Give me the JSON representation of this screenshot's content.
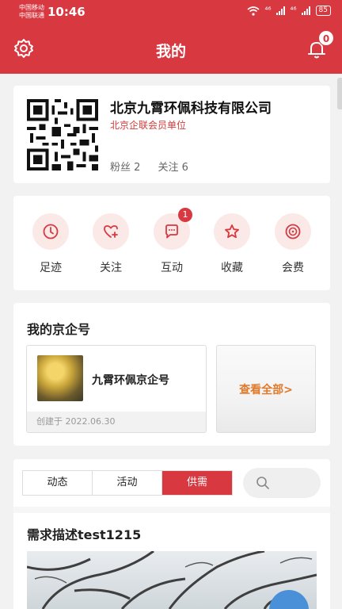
{
  "status": {
    "carrier_1": "中国移动",
    "carrier_2": "中国联通",
    "time": "10:46",
    "signal_1": "⁴⁶",
    "signal_2": "⁴⁶",
    "battery": "85"
  },
  "header": {
    "title": "我的",
    "notification_count": "0",
    "accent": "#d8383f"
  },
  "profile": {
    "company_name": "北京九霄环佩科技有限公司",
    "member_tag": "北京企联会员单位",
    "fans_label": "粉丝",
    "fans_count": "2",
    "follow_label": "关注",
    "follow_count": "6"
  },
  "actions": [
    {
      "label": "足迹",
      "icon": "clock-icon"
    },
    {
      "label": "关注",
      "icon": "heart-plus-icon"
    },
    {
      "label": "互动",
      "icon": "chat-bubble-icon",
      "badge": "1"
    },
    {
      "label": "收藏",
      "icon": "star-icon"
    },
    {
      "label": "会费",
      "icon": "coin-icon"
    }
  ],
  "jingqi": {
    "title": "我的京企号",
    "item_name": "九霄环佩京企号",
    "item_date": "创建于 2022.06.30",
    "view_all": "查看全部>",
    "view_all_color": "#e07a2a"
  },
  "feed": {
    "tabs": [
      "动态",
      "活动",
      "供需"
    ],
    "active_tab": "供需",
    "post_title": "需求描述test1215"
  }
}
